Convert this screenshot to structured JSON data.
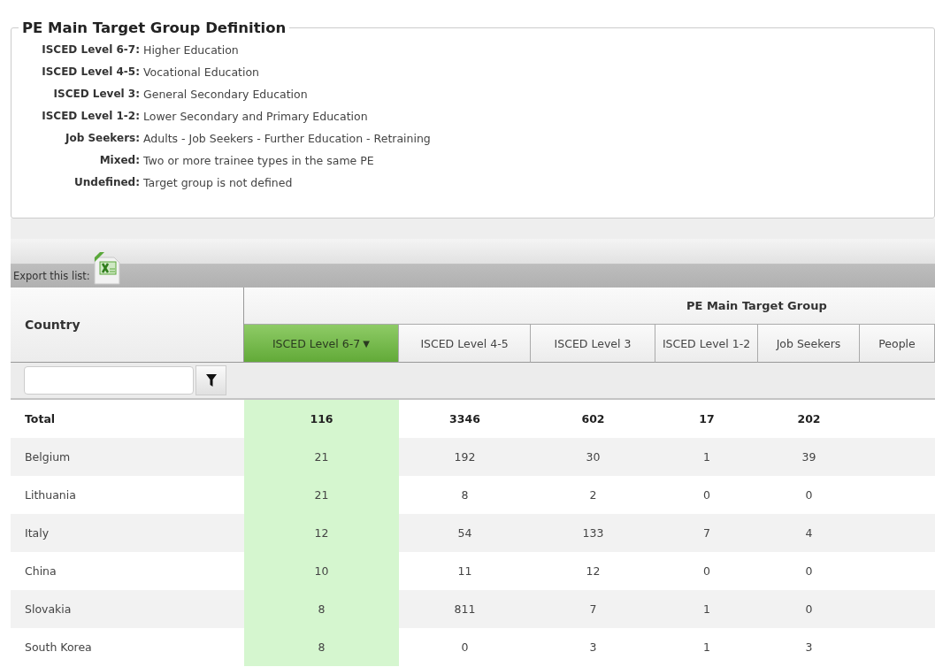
{
  "definition": {
    "title": "PE Main Target Group Definition",
    "items": [
      {
        "term": "ISCED Level 6-7:",
        "description": "Higher Education"
      },
      {
        "term": "ISCED Level 4-5:",
        "description": "Vocational Education"
      },
      {
        "term": "ISCED Level 3:",
        "description": "General Secondary Education"
      },
      {
        "term": "ISCED Level 1-2:",
        "description": "Lower Secondary and Primary Education"
      },
      {
        "term": "Job Seekers:",
        "description": "Adults - Job Seekers - Further Education - Retraining"
      },
      {
        "term": "Mixed:",
        "description": "Two or more trainee types in the same PE"
      },
      {
        "term": "Undefined:",
        "description": "Target group is not defined"
      }
    ]
  },
  "toolbar": {
    "export_label": "Export this list:"
  },
  "table": {
    "country_header": "Country",
    "group_header": "PE Main Target Group",
    "columns": [
      {
        "label": "ISCED Level 6-7",
        "selected": true,
        "sort_indicator": "▼"
      },
      {
        "label": "ISCED Level 4-5",
        "selected": false
      },
      {
        "label": "ISCED Level 3",
        "selected": false
      },
      {
        "label": "ISCED Level 1-2",
        "selected": false
      },
      {
        "label": "Job Seekers",
        "selected": false
      },
      {
        "label": "People",
        "selected": false
      }
    ],
    "rows": [
      {
        "kind": "total",
        "country": "Total",
        "values": [
          "116",
          "3346",
          "602",
          "17",
          "202"
        ]
      },
      {
        "kind": "data",
        "country": "Belgium",
        "values": [
          "21",
          "192",
          "30",
          "1",
          "39"
        ]
      },
      {
        "kind": "data",
        "country": "Lithuania",
        "values": [
          "21",
          "8",
          "2",
          "0",
          "0"
        ]
      },
      {
        "kind": "data",
        "country": "Italy",
        "values": [
          "12",
          "54",
          "133",
          "7",
          "4"
        ]
      },
      {
        "kind": "data",
        "country": "China",
        "values": [
          "10",
          "11",
          "12",
          "0",
          "0"
        ]
      },
      {
        "kind": "data",
        "country": "Slovakia",
        "values": [
          "8",
          "811",
          "7",
          "1",
          "0"
        ]
      },
      {
        "kind": "data",
        "country": "South Korea",
        "values": [
          "8",
          "0",
          "3",
          "1",
          "3"
        ]
      }
    ]
  }
}
